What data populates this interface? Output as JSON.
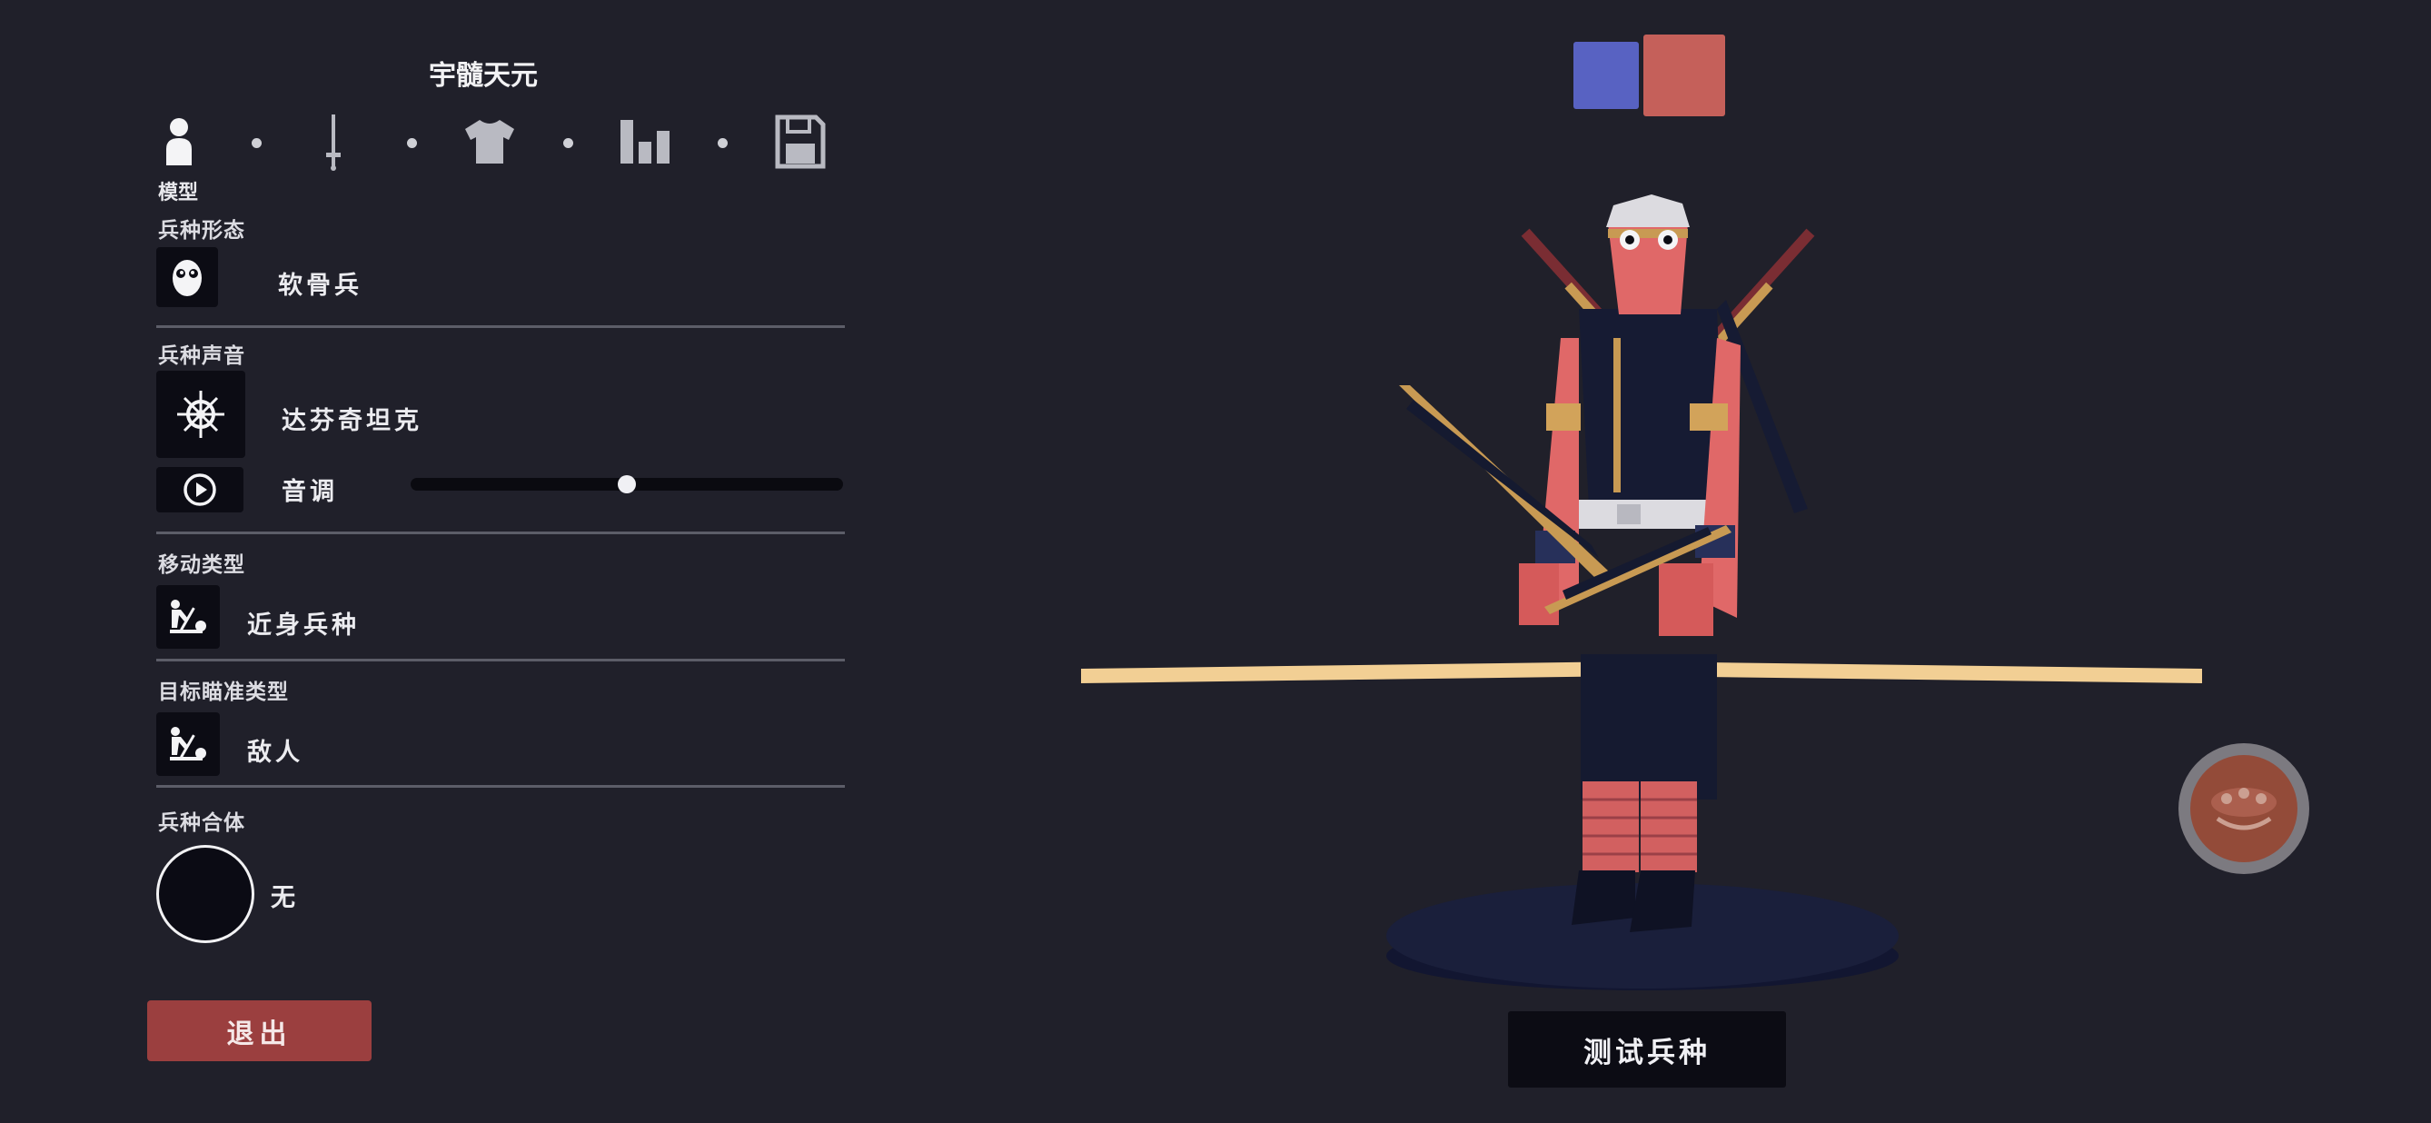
{
  "unit_name": "宇髓天元",
  "steps": {
    "active_label": "模型",
    "icons": [
      "person-icon",
      "sword-icon",
      "shirt-icon",
      "bar-stats-icon",
      "save-icon"
    ]
  },
  "sections": {
    "form": {
      "label": "兵种形态",
      "value": "软骨兵"
    },
    "voice": {
      "label": "兵种声音",
      "value": "达芬奇坦克",
      "pitch_label": "音调",
      "pitch_level": 0.5
    },
    "movement": {
      "label": "移动类型",
      "value": "近身兵种"
    },
    "targeting": {
      "label": "目标瞄准类型",
      "value": "敌人"
    },
    "combine": {
      "label": "兵种合体",
      "value": "无"
    }
  },
  "buttons": {
    "exit": "退出",
    "test": "测试兵种"
  },
  "team_colors": {
    "blue": "#5862c2",
    "red": "#c5605a"
  },
  "colors": {
    "background": "#20202a",
    "panel_box": "#0c0c14",
    "exit_button": "#9b3f3f",
    "ground_line": "#f2cf94",
    "pedestal": "#161b33",
    "unit_skin": "#e06868",
    "unit_clothing": "#151a30"
  }
}
